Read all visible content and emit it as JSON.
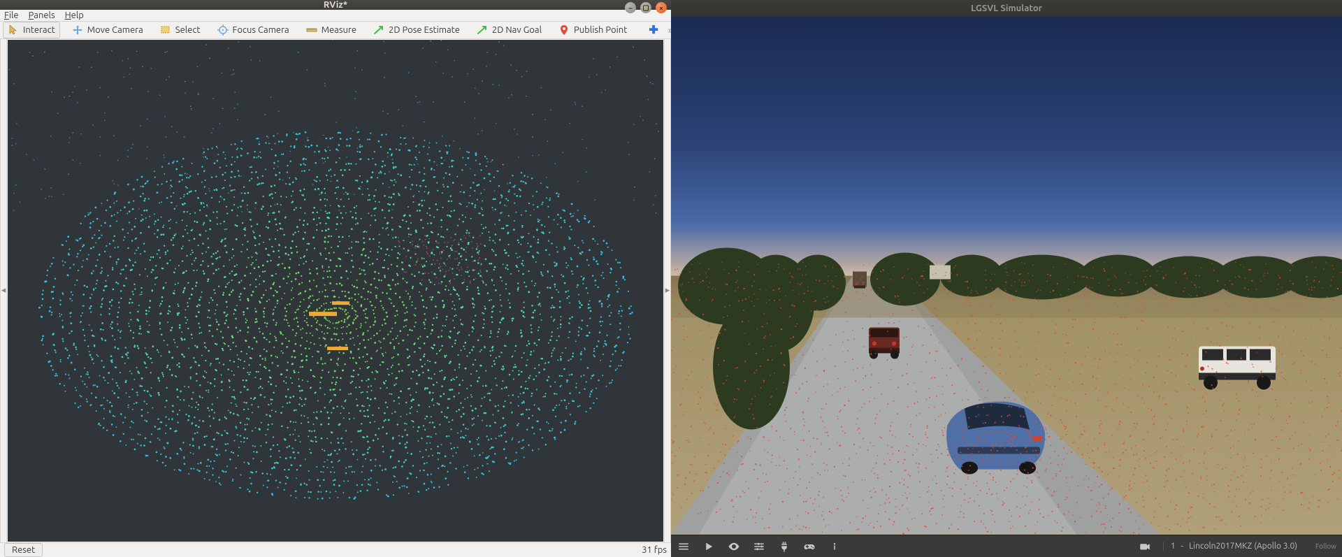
{
  "rviz": {
    "title": "RViz*",
    "menu": {
      "file": "File",
      "panels": "Panels",
      "help": "Help"
    },
    "toolbar": {
      "interact": "Interact",
      "move_camera": "Move Camera",
      "select": "Select",
      "focus_camera": "Focus Camera",
      "measure": "Measure",
      "pose_estimate": "2D Pose Estimate",
      "nav_goal": "2D Nav Goal",
      "publish_point": "Publish Point"
    },
    "status": {
      "reset": "Reset",
      "fps": "31 fps"
    }
  },
  "lgsvl": {
    "title": "LGSVL Simulator",
    "vehicle_index": "1",
    "vehicle_label": "Lincoln2017MKZ (Apollo 3.0)",
    "follow_label": "Follow"
  }
}
